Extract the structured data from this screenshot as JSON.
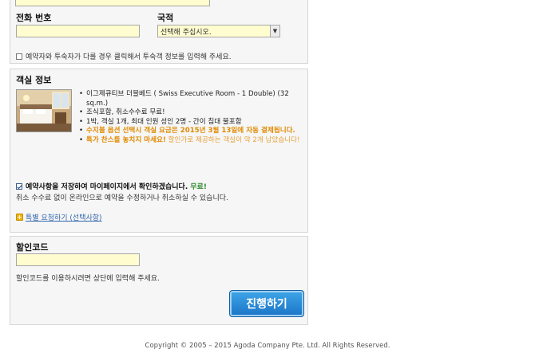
{
  "contact": {
    "phone_label": "전화 번호",
    "phone_value": "",
    "nationality_label": "국적",
    "nationality_selected": "선택해 주십시오.",
    "guest_checkbox_label": "예약자와 투숙자가 다를 경우 클릭해서 투숙객 정보를 입력해 주세요."
  },
  "room": {
    "section_title": "객실 정보",
    "image_icon": "hotel-room-photo",
    "bullets": [
      {
        "text": "이그제큐티브 더블베드 ( Swiss Executive Room - 1 Double) (32 sq.m.)"
      },
      {
        "text": "조식포함, 취소수수료 무료!"
      },
      {
        "text": "1박, 객실 1개, 최대 인원 성인 2명 - 간이 침대 불포함"
      }
    ],
    "warning1": "수지불 옵션 선택시 객실 요금은 2015년 3월 13일에 자동 결제됩니다.",
    "warning2_bold": "특가 찬스를 놓치지 마세요!",
    "warning2_rest": " 할인가로 제공하는 객실이 약 2개 남았습니다!",
    "save_checkbox_label": "예약사항을 저장하여 마이페이지에서 확인하겠습니다.",
    "save_free": "무료!",
    "save_note": "취소 수수료 없이 온라인으로 예약을 수정하거나 취소하실 수 있습니다.",
    "special_request_link": "특별 요청하기 (선택사항)"
  },
  "discount": {
    "label": "할인코드",
    "value": "",
    "note": "할인코드를 이용하시려면 상단에 입력해 주세요."
  },
  "actions": {
    "proceed_label": "진행하기"
  },
  "footer": {
    "copyright": "Copyright © 2005 – 2015 Agoda Company Pte. Ltd. All Rights Reserved."
  },
  "colors": {
    "input_bg": "#fffccf",
    "panel_bg": "#f6f6f6",
    "button_blue": "#1b74c7",
    "warning_orange": "#e08a00",
    "free_green": "#2e8b2e",
    "link_blue": "#3366aa"
  }
}
